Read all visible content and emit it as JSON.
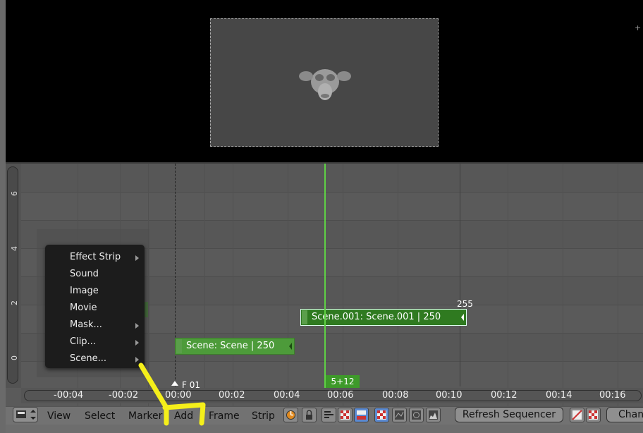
{
  "preview": {
    "monkey_icon": "suzanne-monkey-head"
  },
  "sequencer": {
    "y_ticks": [
      "6",
      "4",
      "2",
      "0"
    ],
    "strip1_label": "Scene.001: Scene.001 | 250",
    "strip2_label": "Scene: Scene | 250",
    "end_frame": "255",
    "playhead_label": "5+12",
    "start_label": "F 01",
    "ghost_strip_label": "Scene: Scene | 250"
  },
  "ruler": {
    "ticks": [
      "-00:04",
      "-00:02",
      "00:00",
      "00:02",
      "00:04",
      "00:06",
      "00:08",
      "00:10",
      "00:12",
      "00:14",
      "00:16"
    ]
  },
  "header": {
    "view": "View",
    "select": "Select",
    "marker": "Marker",
    "add": "Add",
    "frame": "Frame",
    "strip": "Strip",
    "refresh": "Refresh Sequencer",
    "channel": "Chann"
  },
  "add_menu": {
    "items": [
      {
        "label": "Effect Strip",
        "submenu": true
      },
      {
        "label": "Sound",
        "submenu": false
      },
      {
        "label": "Image",
        "submenu": false
      },
      {
        "label": "Movie",
        "submenu": false
      },
      {
        "label": "Mask...",
        "submenu": true
      },
      {
        "label": "Clip...",
        "submenu": true
      },
      {
        "label": "Scene...",
        "submenu": true
      }
    ]
  },
  "colors": {
    "strip_green": "#2f7a20",
    "playhead": "#5fd045",
    "annotation": "#f5ef1a"
  }
}
